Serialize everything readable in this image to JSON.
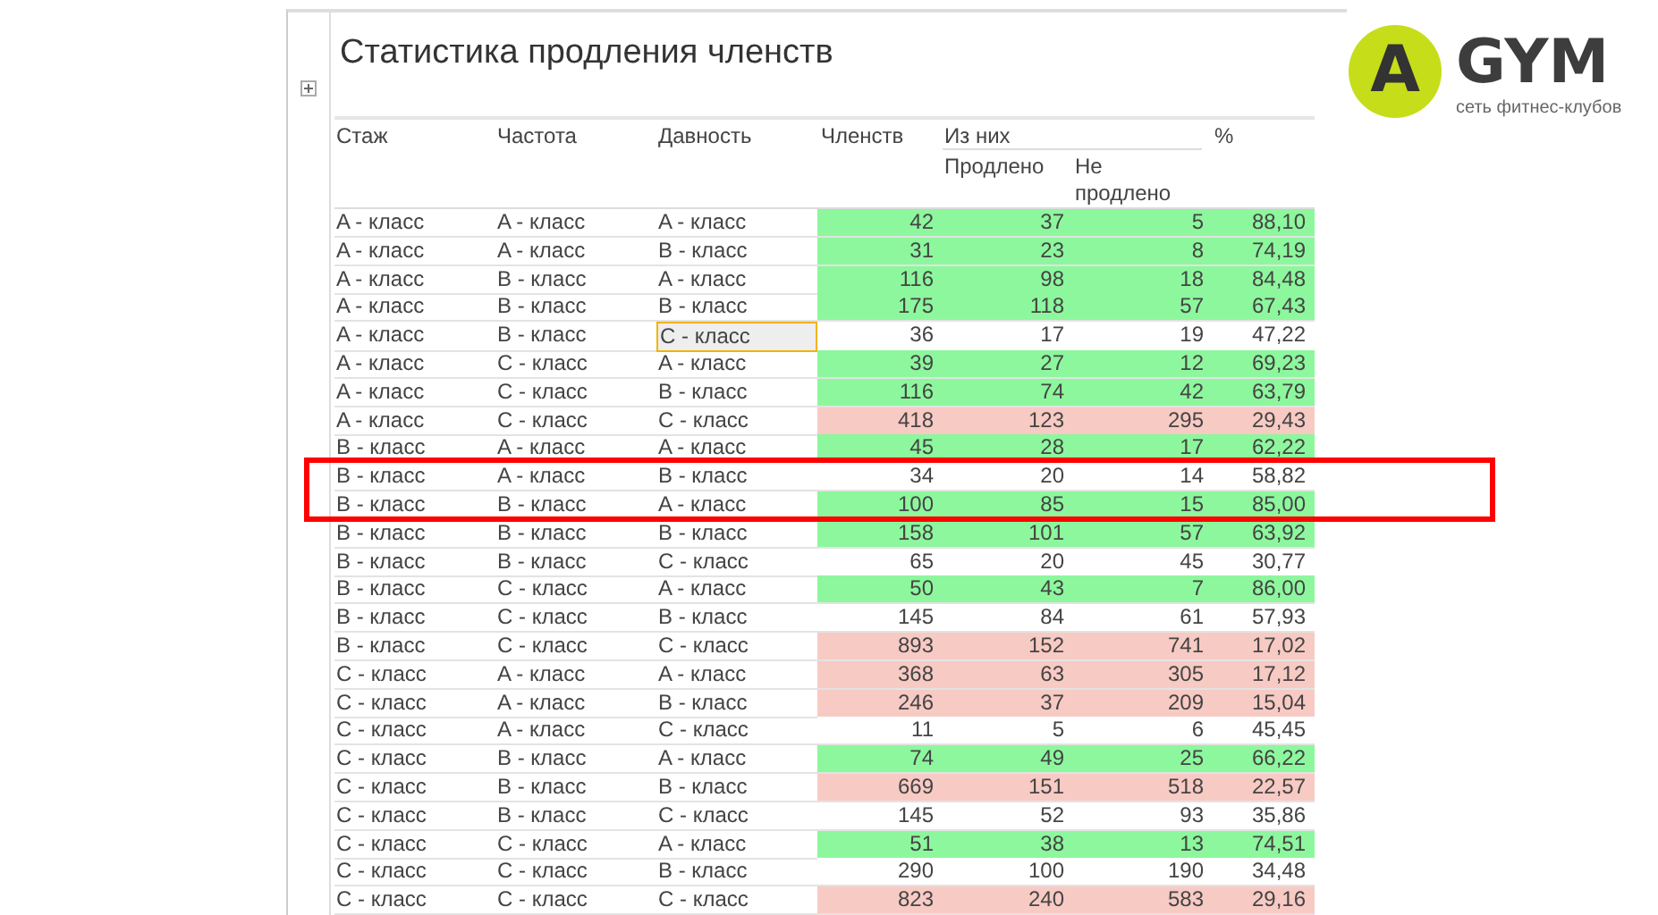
{
  "report": {
    "title": "Статистика продления членств",
    "columns": {
      "tenure": "Стаж",
      "frequency": "Частота",
      "recency": "Давность",
      "members": "Членств",
      "of_them": "Из них",
      "renewed": "Продлено",
      "not_renewed": "Не продлено",
      "percent": "%"
    },
    "rows": [
      {
        "tenure": "A - класс",
        "frequency": "A - класс",
        "recency": "A - класс",
        "members": "42",
        "renewed": "37",
        "not_renewed": "5",
        "percent": "88,10",
        "color": "#8df79d",
        "selected": false,
        "marked": false
      },
      {
        "tenure": "A - класс",
        "frequency": "A - класс",
        "recency": "B - класс",
        "members": "31",
        "renewed": "23",
        "not_renewed": "8",
        "percent": "74,19",
        "color": "#8df79d",
        "selected": false,
        "marked": false
      },
      {
        "tenure": "A - класс",
        "frequency": "B - класс",
        "recency": "A - класс",
        "members": "116",
        "renewed": "98",
        "not_renewed": "18",
        "percent": "84,48",
        "color": "#8df79d",
        "selected": false,
        "marked": false
      },
      {
        "tenure": "A - класс",
        "frequency": "B - класс",
        "recency": "B - класс",
        "members": "175",
        "renewed": "118",
        "not_renewed": "57",
        "percent": "67,43",
        "color": "#8df79d",
        "selected": false,
        "marked": false
      },
      {
        "tenure": "A - класс",
        "frequency": "B - класс",
        "recency": "C - класс",
        "members": "36",
        "renewed": "17",
        "not_renewed": "19",
        "percent": "47,22",
        "color": "#ffffff",
        "selected": true,
        "marked": false
      },
      {
        "tenure": "A - класс",
        "frequency": "C - класс",
        "recency": "A - класс",
        "members": "39",
        "renewed": "27",
        "not_renewed": "12",
        "percent": "69,23",
        "color": "#8df79d",
        "selected": false,
        "marked": false
      },
      {
        "tenure": "A - класс",
        "frequency": "C - класс",
        "recency": "B - класс",
        "members": "116",
        "renewed": "74",
        "not_renewed": "42",
        "percent": "63,79",
        "color": "#8df79d",
        "selected": false,
        "marked": false
      },
      {
        "tenure": "A - класс",
        "frequency": "C - класс",
        "recency": "C - класс",
        "members": "418",
        "renewed": "123",
        "not_renewed": "295",
        "percent": "29,43",
        "color": "#f8cac4",
        "selected": false,
        "marked": false
      },
      {
        "tenure": "B - класс",
        "frequency": "A - класс",
        "recency": "A - класс",
        "members": "45",
        "renewed": "28",
        "not_renewed": "17",
        "percent": "62,22",
        "color": "#8df79d",
        "selected": false,
        "marked": false
      },
      {
        "tenure": "B - класс",
        "frequency": "A - класс",
        "recency": "B - класс",
        "members": "34",
        "renewed": "20",
        "not_renewed": "14",
        "percent": "58,82",
        "color": "#ffffff",
        "selected": false,
        "marked": true
      },
      {
        "tenure": "B - класс",
        "frequency": "B - класс",
        "recency": "A - класс",
        "members": "100",
        "renewed": "85",
        "not_renewed": "15",
        "percent": "85,00",
        "color": "#8df79d",
        "selected": false,
        "marked": true
      },
      {
        "tenure": "B - класс",
        "frequency": "B - класс",
        "recency": "B - класс",
        "members": "158",
        "renewed": "101",
        "not_renewed": "57",
        "percent": "63,92",
        "color": "#8df79d",
        "selected": false,
        "marked": false
      },
      {
        "tenure": "B - класс",
        "frequency": "B - класс",
        "recency": "C - класс",
        "members": "65",
        "renewed": "20",
        "not_renewed": "45",
        "percent": "30,77",
        "color": "#ffffff",
        "selected": false,
        "marked": false
      },
      {
        "tenure": "B - класс",
        "frequency": "C - класс",
        "recency": "A - класс",
        "members": "50",
        "renewed": "43",
        "not_renewed": "7",
        "percent": "86,00",
        "color": "#8df79d",
        "selected": false,
        "marked": false
      },
      {
        "tenure": "B - класс",
        "frequency": "C - класс",
        "recency": "B - класс",
        "members": "145",
        "renewed": "84",
        "not_renewed": "61",
        "percent": "57,93",
        "color": "#ffffff",
        "selected": false,
        "marked": false
      },
      {
        "tenure": "B - класс",
        "frequency": "C - класс",
        "recency": "C - класс",
        "members": "893",
        "renewed": "152",
        "not_renewed": "741",
        "percent": "17,02",
        "color": "#f8cac4",
        "selected": false,
        "marked": false
      },
      {
        "tenure": "C - класс",
        "frequency": "A - класс",
        "recency": "A - класс",
        "members": "368",
        "renewed": "63",
        "not_renewed": "305",
        "percent": "17,12",
        "color": "#f8cac4",
        "selected": false,
        "marked": false
      },
      {
        "tenure": "C - класс",
        "frequency": "A - класс",
        "recency": "B - класс",
        "members": "246",
        "renewed": "37",
        "not_renewed": "209",
        "percent": "15,04",
        "color": "#f8cac4",
        "selected": false,
        "marked": false
      },
      {
        "tenure": "C - класс",
        "frequency": "A - класс",
        "recency": "C - класс",
        "members": "11",
        "renewed": "5",
        "not_renewed": "6",
        "percent": "45,45",
        "color": "#ffffff",
        "selected": false,
        "marked": false
      },
      {
        "tenure": "C - класс",
        "frequency": "B - класс",
        "recency": "A - класс",
        "members": "74",
        "renewed": "49",
        "not_renewed": "25",
        "percent": "66,22",
        "color": "#8df79d",
        "selected": false,
        "marked": false
      },
      {
        "tenure": "C - класс",
        "frequency": "B - класс",
        "recency": "B - класс",
        "members": "669",
        "renewed": "151",
        "not_renewed": "518",
        "percent": "22,57",
        "color": "#f8cac4",
        "selected": false,
        "marked": false
      },
      {
        "tenure": "C - класс",
        "frequency": "B - класс",
        "recency": "C - класс",
        "members": "145",
        "renewed": "52",
        "not_renewed": "93",
        "percent": "35,86",
        "color": "#ffffff",
        "selected": false,
        "marked": false
      },
      {
        "tenure": "C - класс",
        "frequency": "C - класс",
        "recency": "A - класс",
        "members": "51",
        "renewed": "38",
        "not_renewed": "13",
        "percent": "74,51",
        "color": "#8df79d",
        "selected": false,
        "marked": false
      },
      {
        "tenure": "C - класс",
        "frequency": "C - класс",
        "recency": "B - класс",
        "members": "290",
        "renewed": "100",
        "not_renewed": "190",
        "percent": "34,48",
        "color": "#ffffff",
        "selected": false,
        "marked": false
      },
      {
        "tenure": "C - класс",
        "frequency": "C - класс",
        "recency": "C - класс",
        "members": "823",
        "renewed": "240",
        "not_renewed": "583",
        "percent": "29,16",
        "color": "#f8cac4",
        "selected": false,
        "marked": false
      }
    ]
  },
  "logo": {
    "letter": "A",
    "name": "GYM",
    "tagline": "сеть фитнес-клубов"
  }
}
